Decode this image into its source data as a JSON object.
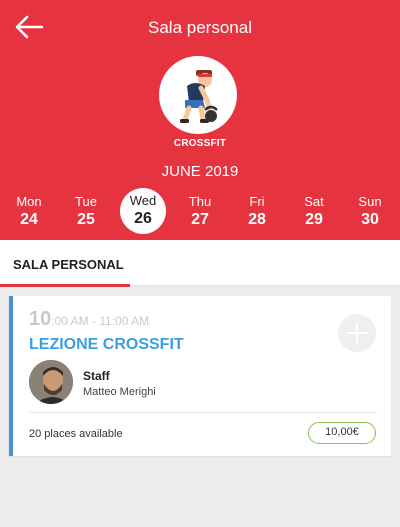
{
  "header": {
    "title": "Sala personal",
    "category": "CROSSFIT",
    "month": "JUNE 2019"
  },
  "days": [
    {
      "name": "Mon",
      "date": "24"
    },
    {
      "name": "Tue",
      "date": "25"
    },
    {
      "name": "Wed",
      "date": "26"
    },
    {
      "name": "Thu",
      "date": "27"
    },
    {
      "name": "Fri",
      "date": "28"
    },
    {
      "name": "Sat",
      "date": "29"
    },
    {
      "name": "Sun",
      "date": "30"
    }
  ],
  "selected_day": "26",
  "tabs": [
    {
      "label": "SALA PERSONAL"
    }
  ],
  "lesson": {
    "time_hour": "10",
    "time_range": ":00 AM - 11:00 AM",
    "title": "LEZIONE CROSSFIT",
    "staff_label": "Staff",
    "staff_name": "Matteo Merighi",
    "places_count": "20",
    "places_text": " places available",
    "price": "10,00€"
  },
  "colors": {
    "header": "#e63340",
    "lesson_title": "#3c9ee2",
    "card_accent": "#4a90d9",
    "price_border": "#8bc34a"
  },
  "icons": {
    "back": "back-arrow-icon",
    "add": "plus-icon",
    "category": "kettlebell-athlete-icon"
  }
}
